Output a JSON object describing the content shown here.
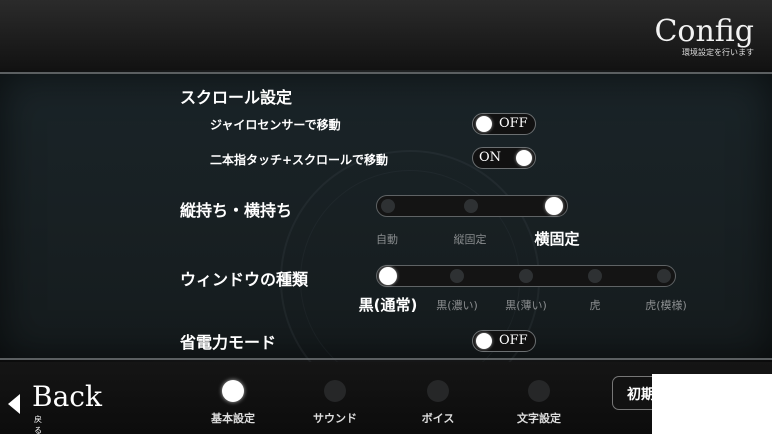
{
  "header": {
    "title": "Config",
    "subtitle": "環境設定を行います"
  },
  "scroll_settings": {
    "section_label": "スクロール設定",
    "gyro": {
      "label": "ジャイロセンサーで移動",
      "state": "OFF"
    },
    "two_finger": {
      "label": "二本指タッチ+スクロールで移動",
      "state": "ON"
    }
  },
  "orientation": {
    "label": "縦持ち・横持ち",
    "options": [
      "自動",
      "縦固定",
      "横固定"
    ],
    "selected_index": 2
  },
  "window_type": {
    "label": "ウィンドウの種類",
    "options": [
      "黒(通常)",
      "黒(濃い)",
      "黒(薄い)",
      "虎",
      "虎(模様)"
    ],
    "selected_index": 0
  },
  "power_save": {
    "label": "省電力モード",
    "state": "OFF"
  },
  "footer": {
    "back_label": "Back",
    "back_sub": "戻る",
    "tabs": [
      "基本設定",
      "サウンド",
      "ボイス",
      "文字設定"
    ],
    "active_tab": 0,
    "reset_label": "初期"
  }
}
